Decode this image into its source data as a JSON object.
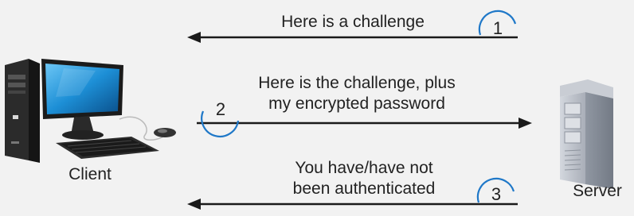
{
  "nodes": {
    "client": {
      "label": "Client"
    },
    "server": {
      "label": "Server"
    }
  },
  "messages": [
    {
      "step": "1",
      "lines": [
        "Here is a challenge"
      ],
      "direction": "server-to-client"
    },
    {
      "step": "2",
      "lines": [
        "Here is the challenge, plus",
        "my encrypted password"
      ],
      "direction": "client-to-server"
    },
    {
      "step": "3",
      "lines": [
        "You have/have not",
        "been authenticated"
      ],
      "direction": "server-to-client"
    }
  ],
  "colors": {
    "background": "#f2f2f2",
    "arrow": "#1a1a1a",
    "step_circle": "#1f78c8",
    "monitor_screen": "#1d8fd6",
    "server_body": "#b7bcc5"
  }
}
